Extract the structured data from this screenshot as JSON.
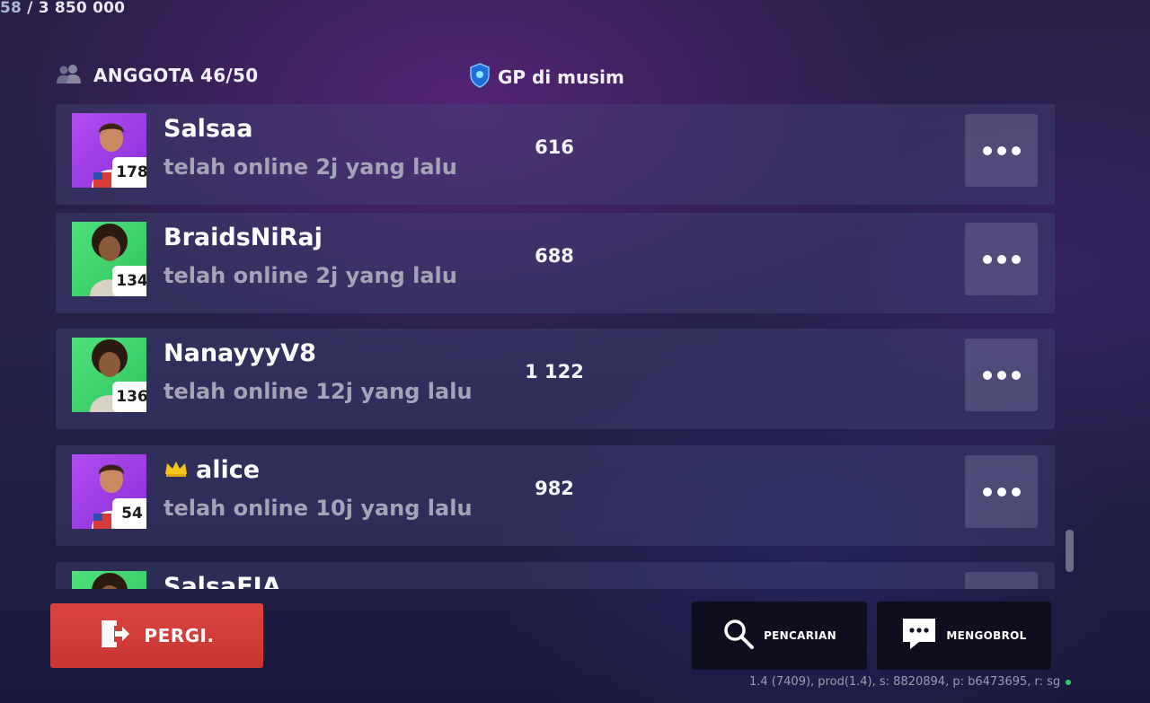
{
  "top_progress": {
    "current": "58",
    "separator": " / ",
    "total": "3 850 000"
  },
  "header": {
    "members_label": "ANGGOTA 46/50",
    "members_icon": "people-icon",
    "gp_label": "GP di musim",
    "gp_icon": "gp-shield-icon"
  },
  "members": [
    {
      "name": "Salsaa",
      "status": "telah online 2j yang lalu",
      "gp": "616",
      "level": "178",
      "avatar_theme": "purple",
      "crown": false
    },
    {
      "name": "BraidsNiRaj",
      "status": "telah online 2j yang lalu",
      "gp": "688",
      "level": "134",
      "avatar_theme": "green",
      "crown": false
    },
    {
      "name": "NanayyyV8",
      "status": "telah online 12j yang lalu",
      "gp": "1 122",
      "level": "136",
      "avatar_theme": "green",
      "crown": false
    },
    {
      "name": "alice",
      "status": "telah online 10j yang lalu",
      "gp": "982",
      "level": "54",
      "avatar_theme": "purple",
      "crown": true
    },
    {
      "name": "SalsaEIA",
      "status": "",
      "gp": "",
      "level": "",
      "avatar_theme": "green",
      "crown": false
    }
  ],
  "buttons": {
    "leave_label": "PERGI.",
    "search_label": "PENCARIAN",
    "chat_label": "MENGOBROL"
  },
  "version_text": "1.4 (7409), prod(1.4), s: 8820894, p: b6473695, r: sg",
  "colors": {
    "leave_button": "#d9443f",
    "row_bg": "#3a3866",
    "avatar_purple": "#9b3fe0",
    "avatar_green": "#3fd36b",
    "status_dot": "#2ecc71"
  }
}
